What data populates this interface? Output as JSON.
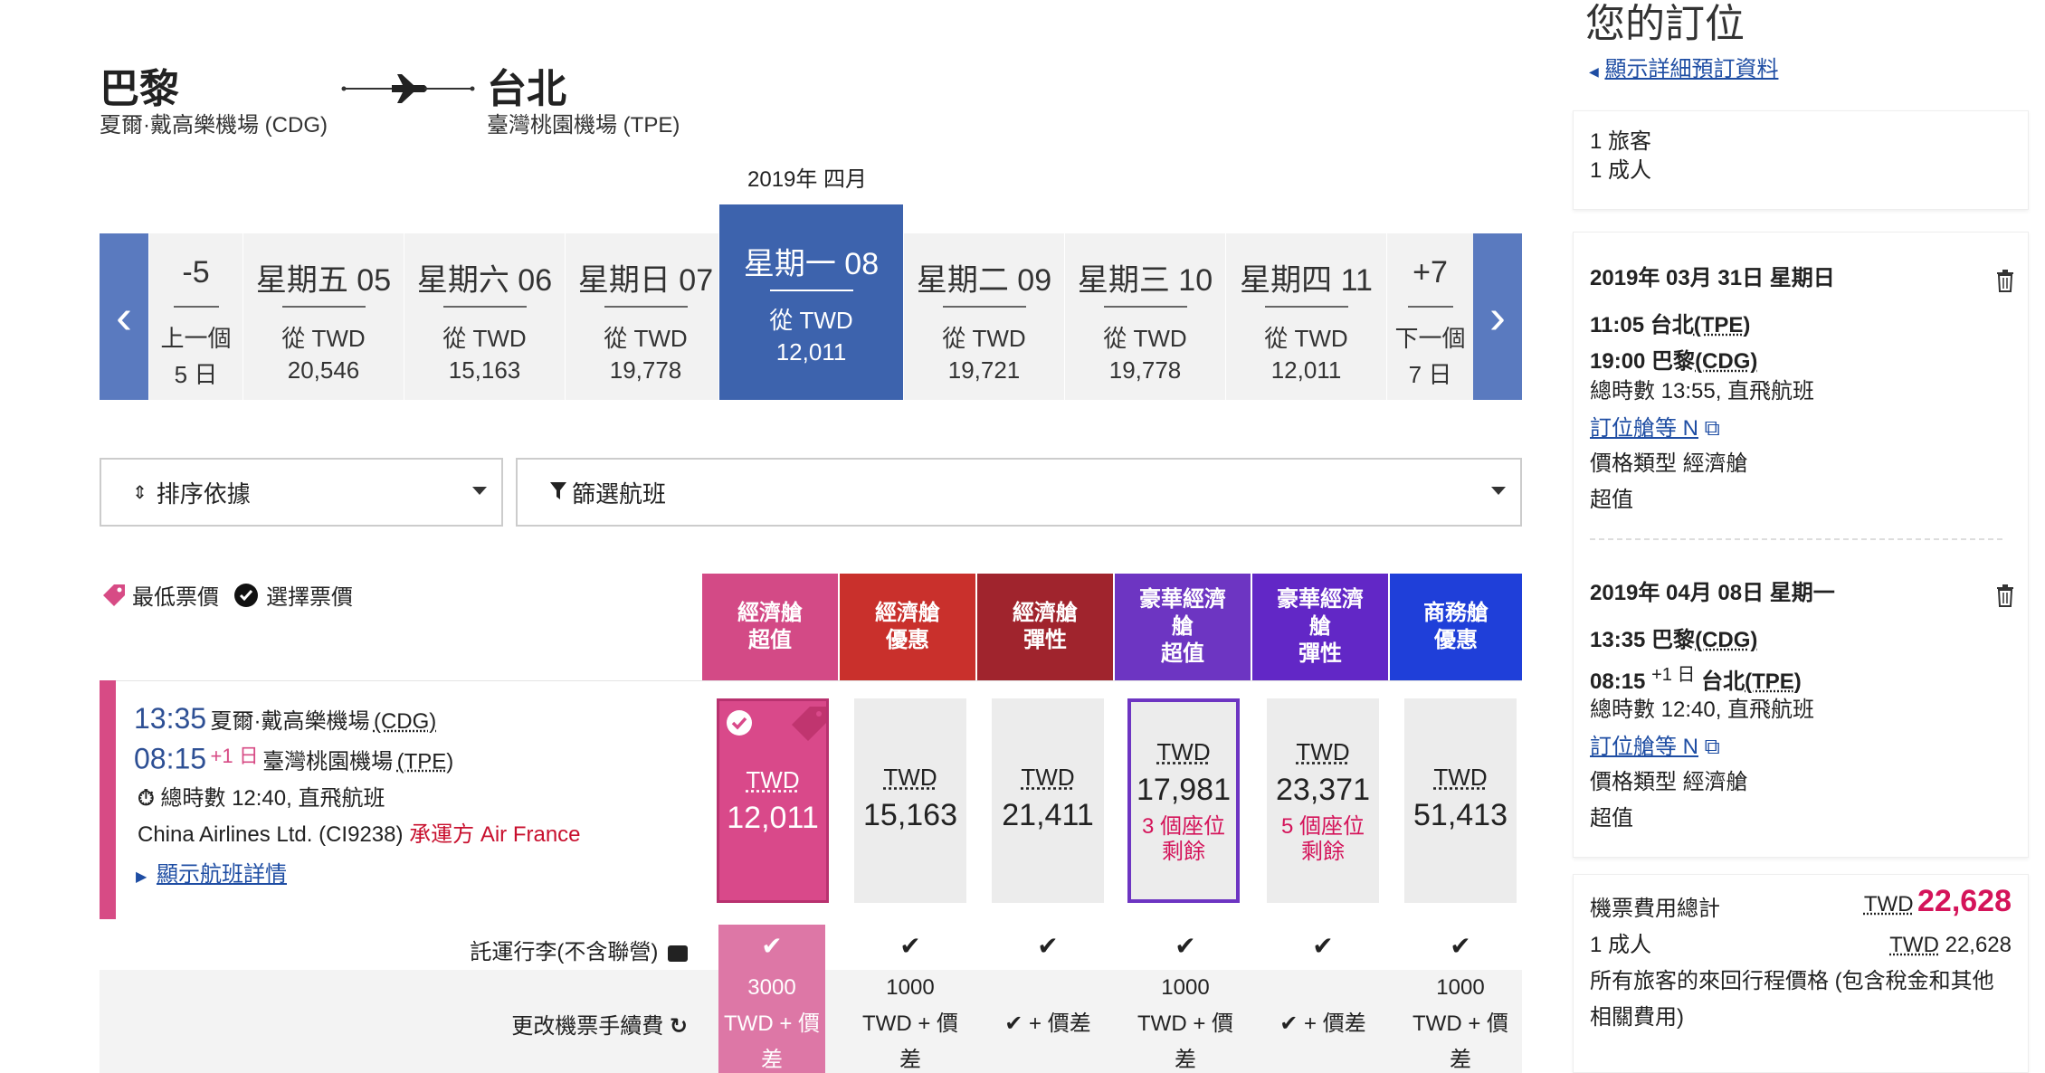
{
  "route": {
    "origin_city": "巴黎",
    "origin_airport": "夏爾·戴高樂機場 (CDG)",
    "dest_city": "台北",
    "dest_airport": "臺灣桃園機場 (TPE)"
  },
  "month_label": "2019年 四月",
  "date_nav": {
    "prev": {
      "top": "-5",
      "mid": "上一個",
      "bottom": "5 日"
    },
    "next": {
      "top": "+7",
      "mid": "下一個",
      "bottom": "7 日"
    }
  },
  "dates": [
    {
      "day": "星期五 05",
      "from": "從 TWD",
      "price": "20,546",
      "selected": false
    },
    {
      "day": "星期六 06",
      "from": "從 TWD",
      "price": "15,163",
      "selected": false
    },
    {
      "day": "星期日 07",
      "from": "從 TWD",
      "price": "19,778",
      "selected": false
    },
    {
      "day": "星期一 08",
      "from": "從 TWD",
      "price": "12,011",
      "selected": true
    },
    {
      "day": "星期二 09",
      "from": "從 TWD",
      "price": "19,721",
      "selected": false
    },
    {
      "day": "星期三 10",
      "from": "從 TWD",
      "price": "19,778",
      "selected": false
    },
    {
      "day": "星期四 11",
      "from": "從 TWD",
      "price": "12,011",
      "selected": false
    }
  ],
  "sort_label": "排序依據",
  "filter_label": "篩選航班",
  "legend": {
    "lowest": "最低票價",
    "selected": "選擇票價"
  },
  "fare_classes": [
    {
      "label1": "經濟艙",
      "label2": "超值",
      "label3": "",
      "color": "#d34a86"
    },
    {
      "label1": "經濟艙",
      "label2": "優惠",
      "label3": "",
      "color": "#c9302c"
    },
    {
      "label1": "經濟艙",
      "label2": "彈性",
      "label3": "",
      "color": "#a0242d"
    },
    {
      "label1": "豪華經濟",
      "label2": "艙",
      "label3": "超值",
      "color": "#6d35c2"
    },
    {
      "label1": "豪華經濟",
      "label2": "艙",
      "label3": "彈性",
      "color": "#6227c6"
    },
    {
      "label1": "商務艙",
      "label2": "優惠",
      "label3": "",
      "color": "#1f3fd9"
    }
  ],
  "flight": {
    "dep_time": "13:35",
    "dep_airport": "夏爾·戴高樂機場",
    "dep_code": "(CDG)",
    "arr_time": "08:15",
    "arr_plus": "+1 日",
    "arr_airport": "臺灣桃園機場",
    "arr_code": "(TPE)",
    "duration": "總時數 12:40, 直飛航班",
    "carrier": "China Airlines Ltd. (CI9238)",
    "operator": "承運方 Air France",
    "details_link": "顯示航班詳情"
  },
  "fares": [
    {
      "currency": "TWD",
      "amount": "12,011",
      "seats": ""
    },
    {
      "currency": "TWD",
      "amount": "15,163",
      "seats": ""
    },
    {
      "currency": "TWD",
      "amount": "21,411",
      "seats": ""
    },
    {
      "currency": "TWD",
      "amount": "17,981",
      "seats": "3 個座位 剩餘"
    },
    {
      "currency": "TWD",
      "amount": "23,371",
      "seats": "5 個座位 剩餘"
    },
    {
      "currency": "TWD",
      "amount": "51,413",
      "seats": ""
    }
  ],
  "baggage_label": "託運行李(不含聯營)",
  "change_fee_label": "更改機票手續費",
  "change_fees": [
    {
      "l1": "3000",
      "l2": "TWD + 價",
      "l3": "差"
    },
    {
      "l1": "1000",
      "l2": "TWD + 價",
      "l3": "差"
    },
    {
      "l1": "",
      "l2": "✔ + 價差",
      "l3": ""
    },
    {
      "l1": "1000",
      "l2": "TWD + 價",
      "l3": "差"
    },
    {
      "l1": "",
      "l2": "✔ + 價差",
      "l3": ""
    },
    {
      "l1": "1000",
      "l2": "TWD + 價",
      "l3": "差"
    }
  ],
  "sidebar": {
    "title": "您的訂位",
    "details_link": "顯示詳細預訂資料",
    "travelers": "1 旅客",
    "adults": "1 成人",
    "outbound": {
      "date": "2019年 03月 31日 星期日",
      "dep": "11:05 台北",
      "dep_code": "(TPE)",
      "arr": "19:00 巴黎",
      "arr_code": "(CDG)",
      "duration": "總時數 13:55, 直飛航班",
      "booking_class": "訂位艙等 N",
      "fare_type": "價格類型 經濟艙",
      "fare_name": "超值"
    },
    "inbound": {
      "date": "2019年 04月 08日 星期一",
      "dep": "13:35 巴黎",
      "dep_code": "(CDG)",
      "arr_time": "08:15",
      "arr_plus": "+1 日",
      "arr_city": "台北",
      "arr_code": "(TPE)",
      "duration": "總時數 12:40, 直飛航班",
      "booking_class": "訂位艙等 N",
      "fare_type": "價格類型 經濟艙",
      "fare_name": "超值"
    },
    "total_label": "機票費用總計",
    "total_currency": "TWD",
    "total_amount": "22,628",
    "adult_label": "1 成人",
    "adult_currency": "TWD",
    "adult_amount": "22,628",
    "note": "所有旅客的來回行程價格 (包含稅金和其他相關費用)"
  }
}
